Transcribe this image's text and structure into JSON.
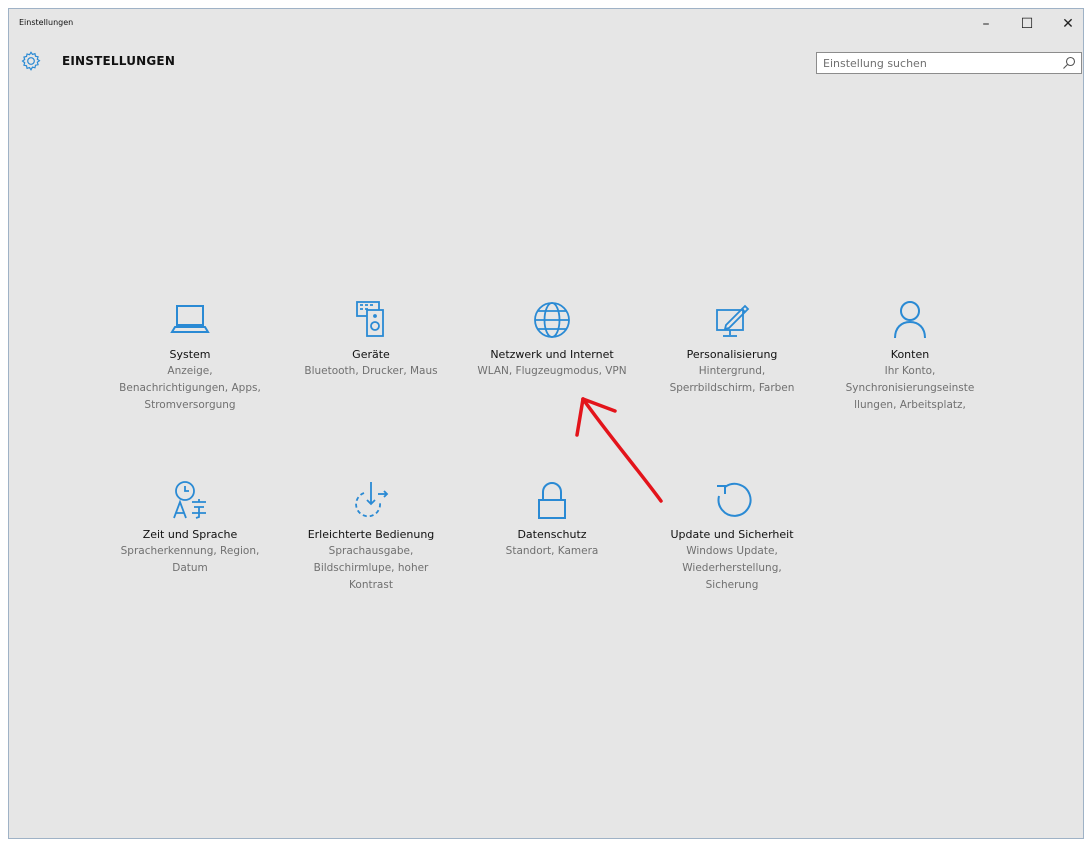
{
  "window": {
    "title": "Einstellungen",
    "minimize": "–",
    "maximize": "☐",
    "close": "✕"
  },
  "header": {
    "icon": "gear-icon",
    "title": "EINSTELLUNGEN"
  },
  "search": {
    "placeholder": "Einstellung suchen",
    "value": "",
    "icon": "search-icon"
  },
  "accent_color": "#2a8ad4",
  "tiles": [
    {
      "icon": "laptop-icon",
      "title": "System",
      "desc": "Anzeige, Benachrichtigungen, Apps, Stromversorgung"
    },
    {
      "icon": "devices-icon",
      "title": "Geräte",
      "desc": "Bluetooth, Drucker, Maus"
    },
    {
      "icon": "globe-icon",
      "title": "Netzwerk und Internet",
      "desc": "WLAN, Flugzeugmodus, VPN"
    },
    {
      "icon": "personalization-icon",
      "title": "Personalisierung",
      "desc": "Hintergrund, Sperrbildschirm, Farben"
    },
    {
      "icon": "person-icon",
      "title": "Konten",
      "desc": "Ihr Konto, Synchronisierungseinste llungen, Arbeitsplatz,"
    },
    {
      "icon": "time-language-icon",
      "title": "Zeit und Sprache",
      "desc": "Spracherkennung, Region, Datum"
    },
    {
      "icon": "ease-of-access-icon",
      "title": "Erleichterte Bedienung",
      "desc": "Sprachausgabe, Bildschirmlupe, hoher Kontrast"
    },
    {
      "icon": "lock-icon",
      "title": "Datenschutz",
      "desc": "Standort, Kamera"
    },
    {
      "icon": "update-icon",
      "title": "Update und Sicherheit",
      "desc": "Windows Update, Wiederherstellung, Sicherung"
    }
  ],
  "annotation": {
    "icon": "red-arrow-icon",
    "color": "#e3141b"
  }
}
